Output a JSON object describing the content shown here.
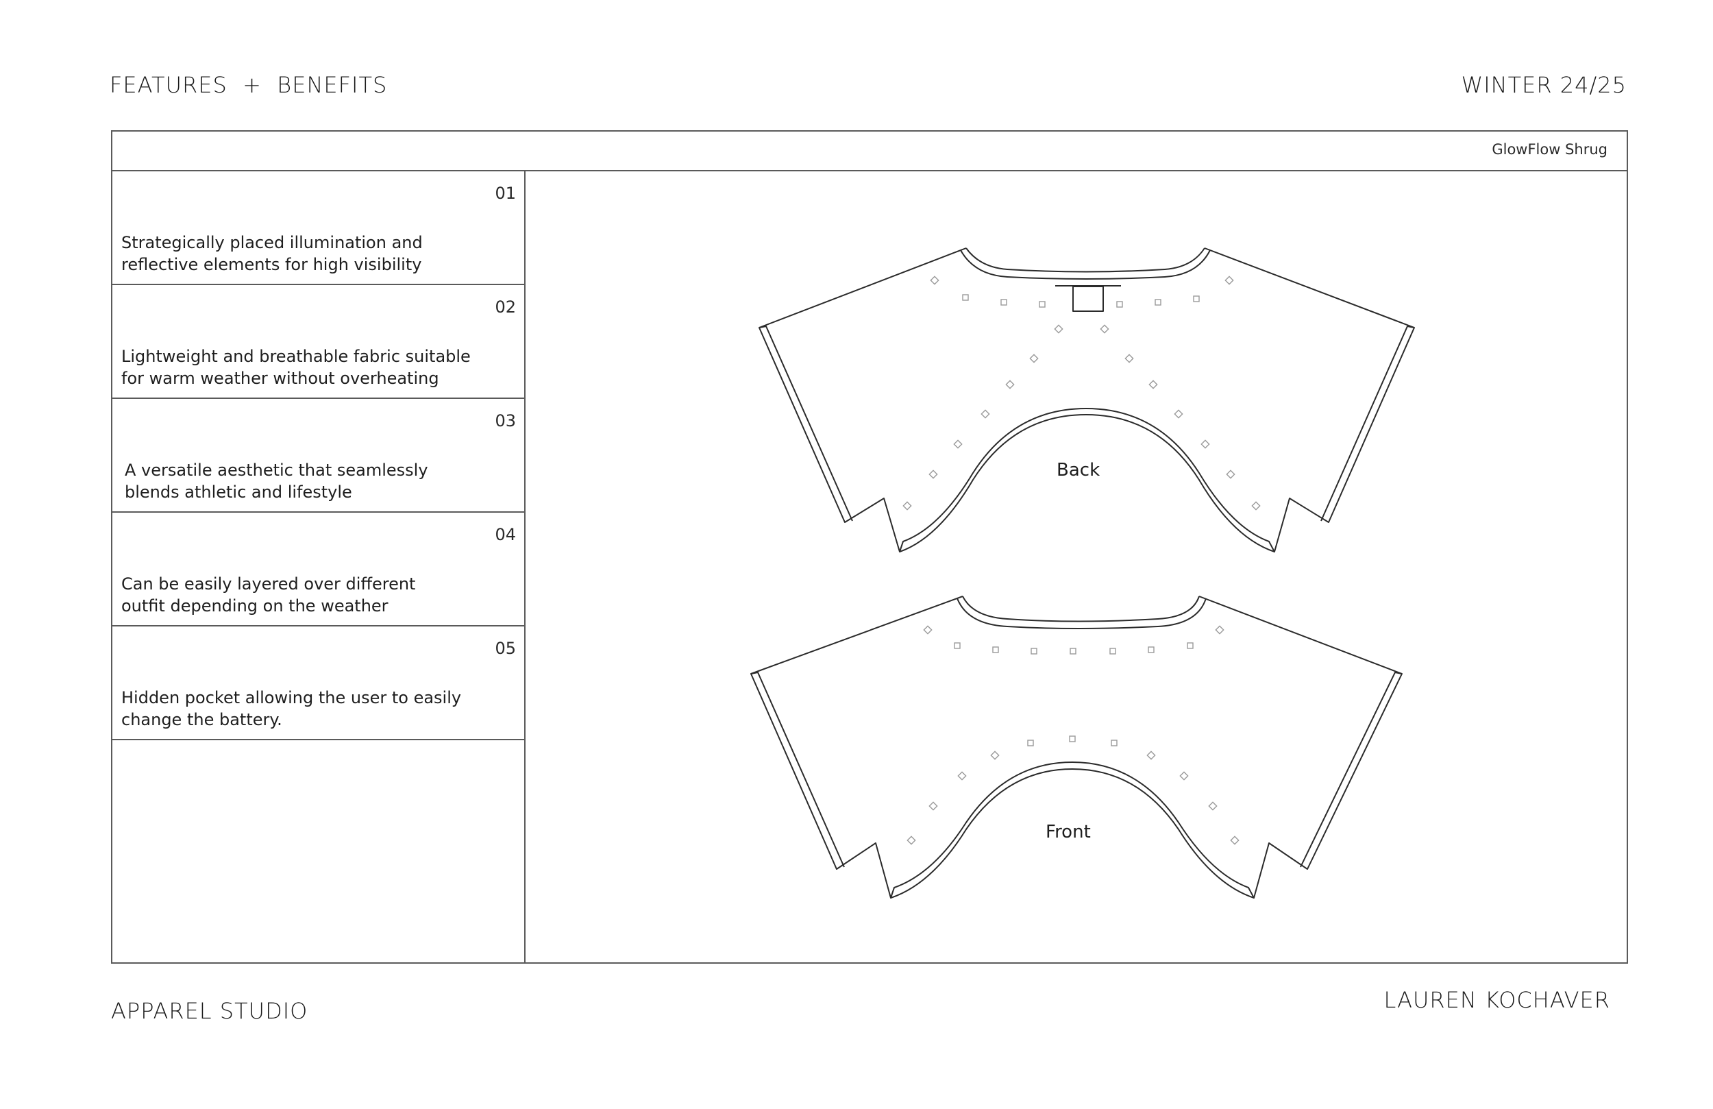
{
  "header": {
    "title": "FEATURES  +  BENEFITS",
    "season": "WINTER 24/25"
  },
  "product": {
    "name": "GlowFlow Shrug"
  },
  "features": [
    {
      "number": "01",
      "text": "Strategically placed illumination and reflective elements for high visibility"
    },
    {
      "number": "02",
      "text": "Lightweight and breathable fabric suitable for warm weather without overheating"
    },
    {
      "number": "03",
      "text": "A versatile aesthetic that seamlessly blends athletic and lifestyle"
    },
    {
      "number": "04",
      "text": "Can be easily layered over different outfit depending on the weather"
    },
    {
      "number": "05",
      "text": "Hidden pocket allowing the user to easily change the battery."
    }
  ],
  "drawings": {
    "back_label": "Back",
    "front_label": "Front"
  },
  "footer": {
    "studio": "APPAREL STUDIO",
    "designer": "LAUREN KOCHAVER"
  }
}
